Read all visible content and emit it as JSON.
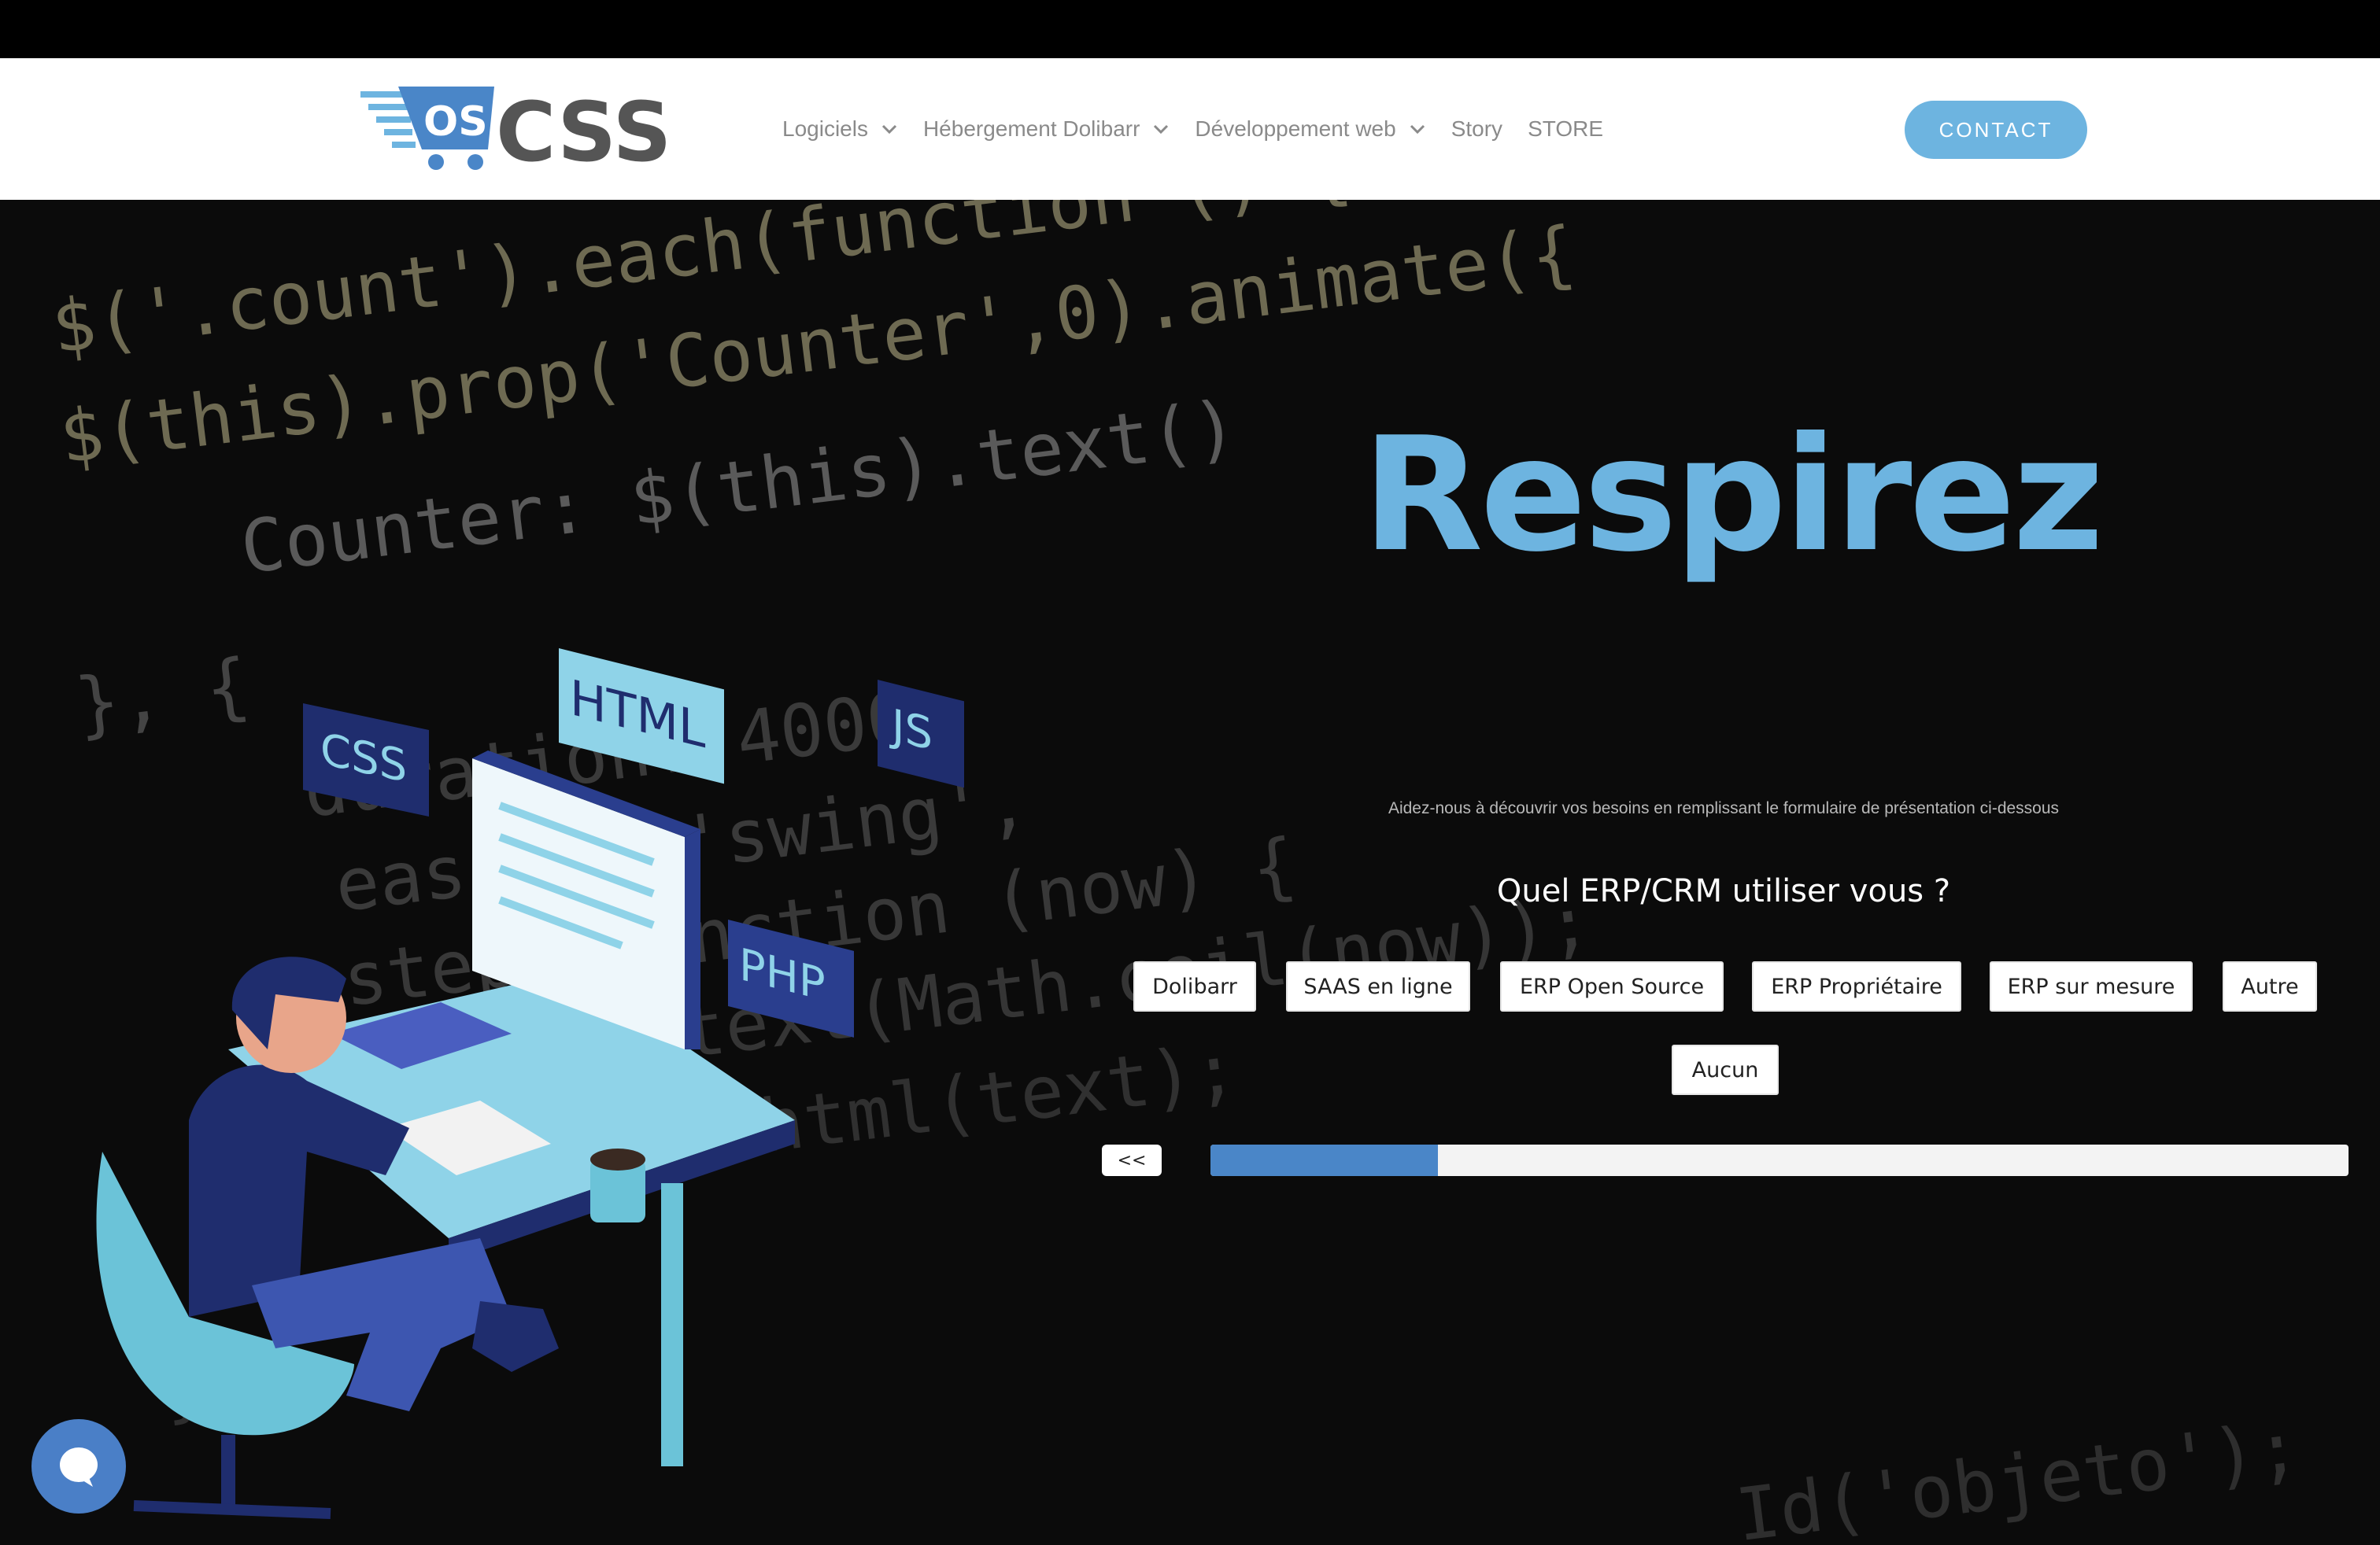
{
  "header": {
    "logo": {
      "badge_text": "OS",
      "brand_text": "CSS"
    },
    "nav": [
      {
        "label": "Logiciels",
        "has_dropdown": true
      },
      {
        "label": "Hébergement Dolibarr",
        "has_dropdown": true
      },
      {
        "label": "Développement web",
        "has_dropdown": true
      },
      {
        "label": "Story",
        "has_dropdown": false
      },
      {
        "label": "STORE",
        "has_dropdown": false
      }
    ],
    "contact_label": "CONTACT"
  },
  "hero": {
    "headline": "Respirez",
    "subline": "Aidez-nous à découvrir vos besoins en remplissant le formulaire de présentation ci-dessous",
    "illustration_labels": {
      "css": "CSS",
      "html": "HTML",
      "js": "JS",
      "php": "PHP"
    },
    "code_lines": [
      "$('.count').each(function () {",
      "$(this).prop('Counter',0).animate({",
      "Counter: $(this).text()",
      "}, {",
      "duration: 4000,",
      "easing: 'swing',",
      "step: function (now) {",
      "$(this).text(Math.ceil(now));",
      "$(this).html(text);",
      "});",
      "Id('objeto');"
    ]
  },
  "form": {
    "question": "Quel ERP/CRM utiliser vous ?",
    "options": [
      "Dolibarr",
      "SAAS en ligne",
      "ERP Open Source",
      "ERP Propriétaire",
      "ERP sur mesure",
      "Autre",
      "Aucun"
    ],
    "back_label": "<<",
    "progress": 0.2
  },
  "colors": {
    "accent": "#6db4e0",
    "progress": "#4a86c8",
    "chat": "#4a7fc7",
    "nav_text": "#8a8a8a"
  },
  "icons": {
    "chat": "chat-bubble-icon",
    "dropdown": "chevron-down-icon"
  }
}
